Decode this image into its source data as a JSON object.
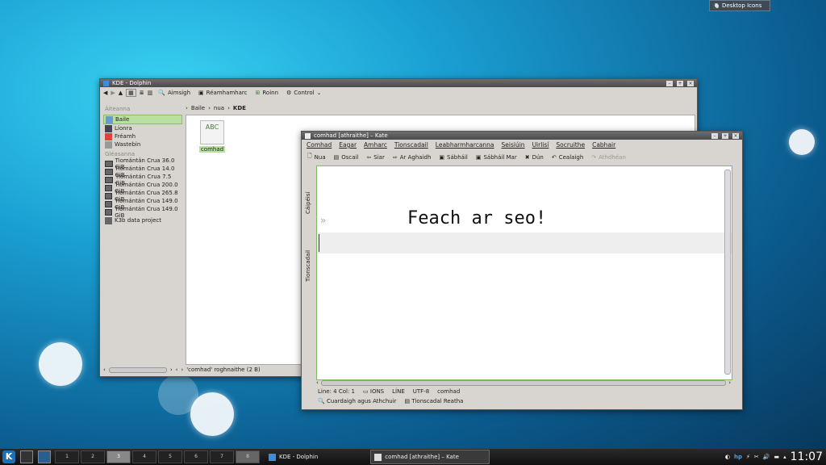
{
  "desktop": {
    "icons_button": "Desktop Icons"
  },
  "dolphin": {
    "title": "KDE - Dolphin",
    "toolbar": [
      "Aimsigh",
      "Réamhamharc",
      "Roinn",
      "Control"
    ],
    "places_header": "Áiteanna",
    "places": [
      "Baile",
      "Líonra",
      "Fréamh",
      "Wastebin"
    ],
    "devices_header": "Gléasanna",
    "devices": [
      "Tiomántán Crua 36.0 GiB",
      "Tiomántán Crua 14.0 GiB",
      "Tiomántán Crua 7.5 GiB",
      "Tiomántán Crua 200.0 GiB",
      "Tiomántán Crua 265.8 GiB",
      "Tiomántán Crua 149.0 GiB",
      "Tiomántán Crua 149.0 GiB",
      "K3b data project"
    ],
    "breadcrumb": [
      "Baile",
      "nua",
      "KDE"
    ],
    "file": {
      "name": "comhad",
      "thumb": "ABC"
    },
    "status": "'comhad' roghnaithe (2 B)"
  },
  "kate": {
    "title": "comhad [athraithe] – Kate",
    "menu": [
      "Comhad",
      "Eagar",
      "Amharc",
      "Tionscadail",
      "Leabharmharcanna",
      "Seisiúin",
      "Uirlisí",
      "Socruithe",
      "Cabhair"
    ],
    "toolbar": [
      "Nua",
      "Oscail",
      "Siar",
      "Ar Aghaidh",
      "Sábháil",
      "Sábháil Mar",
      "Dún",
      "Cealaigh",
      "Athdhéan"
    ],
    "side_tabs": [
      "Cáipéisí",
      "Tionscadail"
    ],
    "text": "Feach ar seo!",
    "status": {
      "position": "Line: 4 Col: 1",
      "mode": "IONS",
      "line_mode": "LÍNE",
      "encoding": "UTF-8",
      "file": "comhad"
    },
    "bottom_tabs": [
      "Cuardaigh agus Athchuir",
      "Tionscadal Reatha"
    ]
  },
  "taskbar": {
    "desktops": [
      "1",
      "2",
      "3",
      "4",
      "5",
      "6",
      "7",
      "8"
    ],
    "tasks": [
      "KDE - Dolphin",
      "comhad [athraithe] – Kate"
    ],
    "clock": "11:07"
  }
}
